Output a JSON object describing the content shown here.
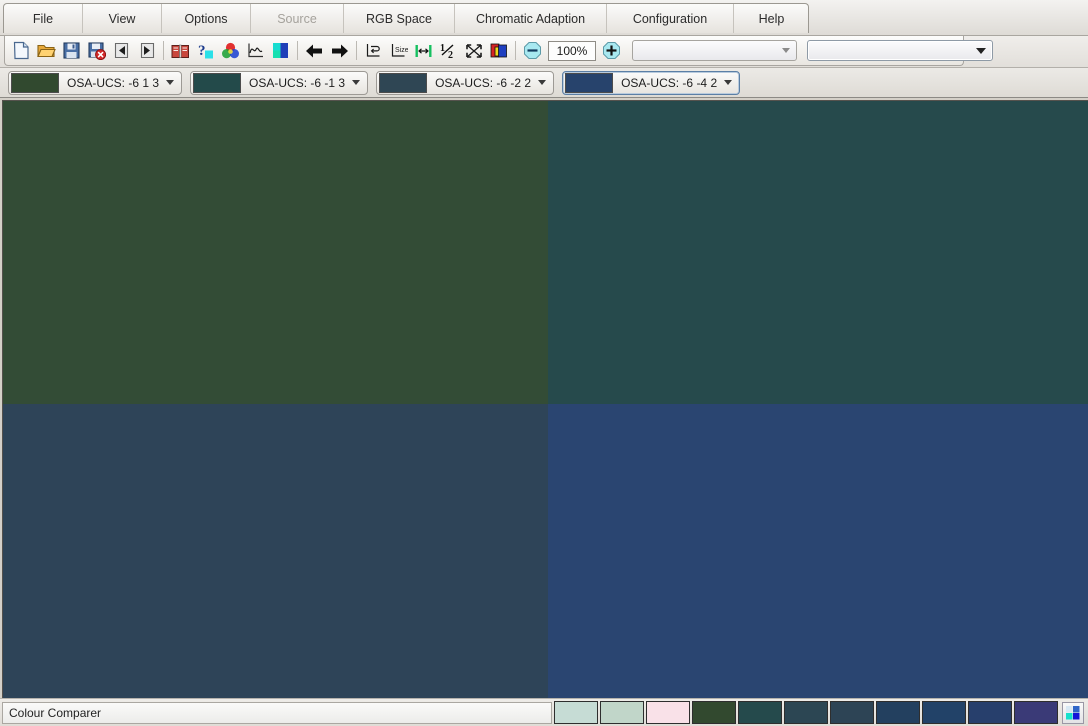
{
  "app": {
    "title": "Colour Comparer"
  },
  "menubar": {
    "items": [
      {
        "label": "File",
        "icon": "menu-file",
        "disabled": false,
        "width_class": "menu-w-file"
      },
      {
        "label": "View",
        "icon": "menu-view",
        "disabled": false,
        "width_class": "menu-w-view"
      },
      {
        "label": "Options",
        "icon": "menu-options",
        "disabled": false,
        "width_class": "menu-w-options"
      },
      {
        "label": "Source",
        "icon": "menu-source",
        "disabled": true,
        "width_class": "menu-w-source"
      },
      {
        "label": "RGB Space",
        "icon": "menu-rgb",
        "disabled": false,
        "width_class": "menu-w-rgb"
      },
      {
        "label": "Chromatic Adaption",
        "icon": "menu-chromatic",
        "disabled": false,
        "width_class": "menu-w-chromatic"
      },
      {
        "label": "Configuration",
        "icon": "menu-config",
        "disabled": false,
        "width_class": "menu-w-config"
      },
      {
        "label": "Help",
        "icon": "menu-help",
        "disabled": false,
        "width_class": "menu-w-help"
      }
    ]
  },
  "toolbar": {
    "buttons": [
      {
        "icon": "new-document-icon",
        "title": "New"
      },
      {
        "icon": "open-folder-icon",
        "title": "Open"
      },
      {
        "icon": "save-floppy-icon",
        "title": "Save"
      },
      {
        "icon": "save-delete-icon",
        "title": "Delete"
      },
      {
        "icon": "previous-page-icon",
        "title": "Previous"
      },
      {
        "icon": "next-page-icon",
        "title": "Next"
      },
      {
        "icon": "book-icon",
        "title": "Catalogue"
      },
      {
        "icon": "help-question-icon",
        "title": "What's This"
      },
      {
        "icon": "colour-wheel-icon",
        "title": "Colour Wheel"
      },
      {
        "icon": "spectrum-graph-icon",
        "title": "Spectrum"
      },
      {
        "icon": "colour-blocks-icon",
        "title": "Colour Blocks"
      },
      {
        "icon": "back-arrow-icon",
        "title": "Back"
      },
      {
        "icon": "forward-arrow-icon",
        "title": "Forward"
      },
      {
        "icon": "fit-window-icon",
        "title": "Fit To Window"
      },
      {
        "icon": "actual-size-icon",
        "title": "Actual Size"
      },
      {
        "icon": "fit-width-icon",
        "title": "Fit Width"
      },
      {
        "icon": "half-size-icon",
        "title": "Half Size"
      },
      {
        "icon": "fullscreen-icon",
        "title": "Full Screen"
      },
      {
        "icon": "layers-icon",
        "title": "Layers"
      }
    ],
    "zoom_out_icon": "zoom-out-icon",
    "zoom_in_icon": "zoom-in-icon",
    "zoom_value": "100%",
    "combo_left_value": "",
    "combo_right_value": ""
  },
  "colour_tabs": [
    {
      "label": "OSA-UCS: -6 1 3",
      "swatch": "#31492f",
      "active": false
    },
    {
      "label": "OSA-UCS: -6 -1 3",
      "swatch": "#234a4a",
      "active": false
    },
    {
      "label": "OSA-UCS: -6 -2 2",
      "swatch": "#2f4654",
      "active": false
    },
    {
      "label": "OSA-UCS: -6 -4 2",
      "swatch": "#27436c",
      "active": true
    }
  ],
  "canvas": {
    "quadrants": [
      {
        "name": "top-left",
        "colour": "#334c36"
      },
      {
        "name": "top-right",
        "colour": "#264a4c"
      },
      {
        "name": "bottom-left",
        "colour": "#2e4458"
      },
      {
        "name": "bottom-right",
        "colour": "#2a4571"
      }
    ]
  },
  "statusbar": {
    "message": "Colour Comparer",
    "palette": [
      "#c6dcd5",
      "#c1d6c9",
      "#f9e1e8",
      "#32492f",
      "#254a4c",
      "#2c4653",
      "#2d4455",
      "#23405f",
      "#224268",
      "#273f6c",
      "#3a3a77"
    ],
    "palette_button_icon": "colour-blocks-icon"
  }
}
